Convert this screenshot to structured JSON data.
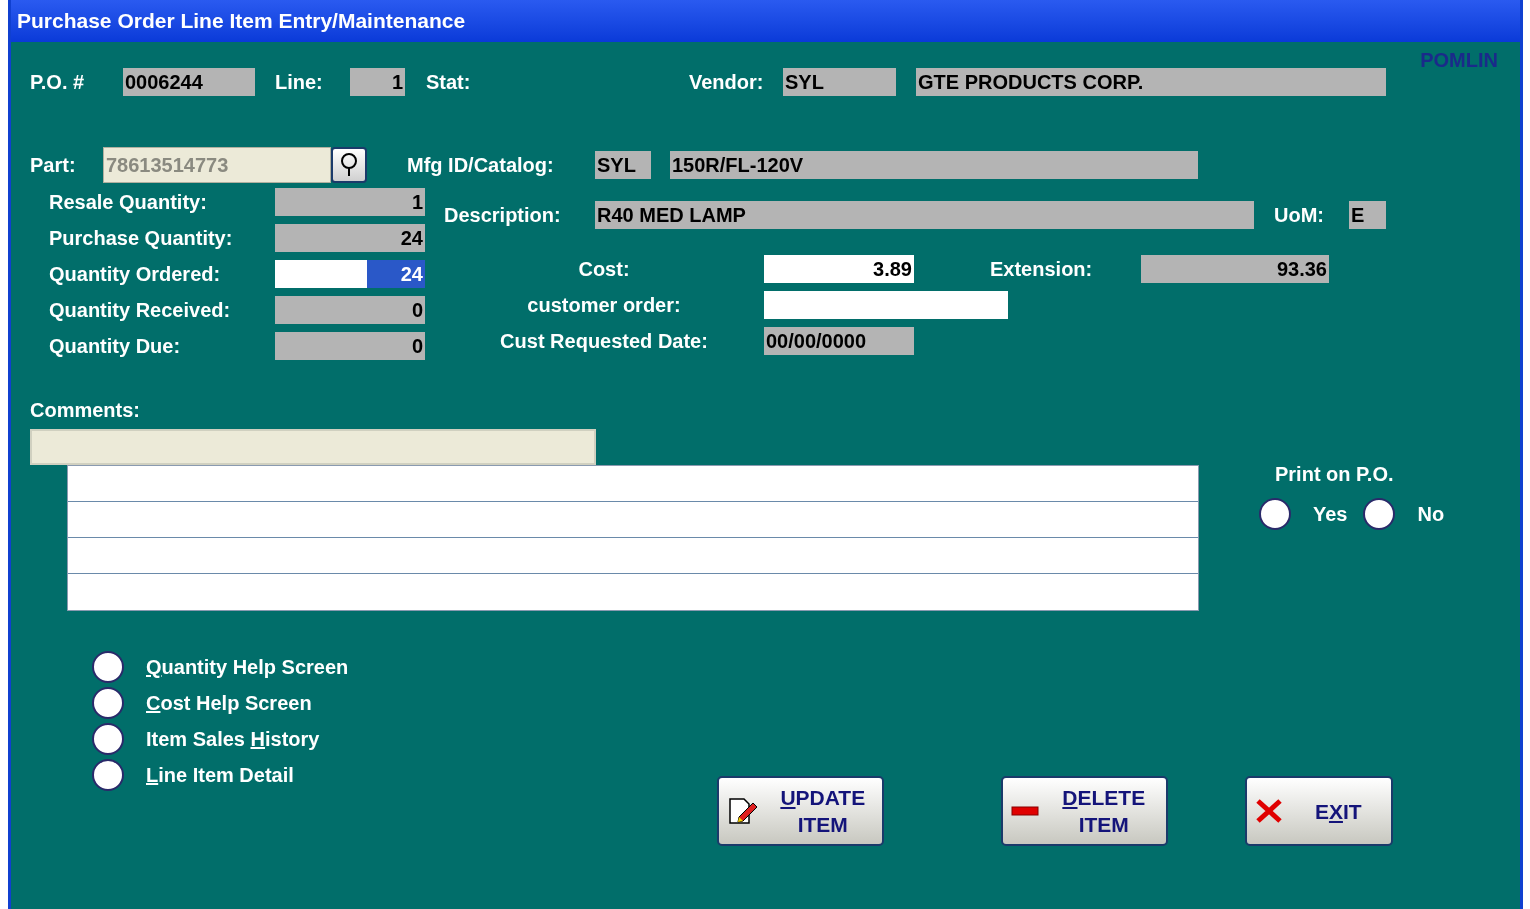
{
  "window": {
    "title": "Purchase Order Line Item Entry/Maintenance",
    "form_code": "POMLIN"
  },
  "header": {
    "po_label": "P.O. #",
    "po": "0006244",
    "line_label": "Line:",
    "line": "1",
    "stat_label": "Stat:",
    "vendor_label": "Vendor:",
    "vendor_code": "SYL",
    "vendor_name": "GTE PRODUCTS CORP."
  },
  "part": {
    "label": "Part:",
    "value": "78613514773",
    "disabled": true
  },
  "mfg": {
    "label": "Mfg ID/Catalog:",
    "code": "SYL",
    "catalog": "150R/FL-120V"
  },
  "description": {
    "label": "Description:",
    "value": "R40 MED LAMP",
    "uom_label": "UoM:",
    "uom": "E"
  },
  "quantities": [
    {
      "label": "Resale Quantity:",
      "value": "1",
      "kind": "readonly"
    },
    {
      "label": "Purchase Quantity:",
      "value": "24",
      "kind": "readonly"
    },
    {
      "label": "Quantity Ordered:",
      "value": "24",
      "kind": "editable",
      "text_selected": true
    },
    {
      "label": "Quantity Received:",
      "value": "0",
      "kind": "readonly"
    },
    {
      "label": "Quantity Due:",
      "value": "0",
      "kind": "readonly"
    }
  ],
  "pricing": [
    {
      "label": "Cost:",
      "value": "3.89",
      "kind": "amount"
    },
    {
      "label": "customer order:",
      "kind": "text"
    },
    {
      "label": "Cust Requested Date:",
      "value": "00/00/0000",
      "kind": "date"
    }
  ],
  "extension": {
    "label": "Extension:",
    "value": "93.36"
  },
  "comments": {
    "label": "Comments:"
  },
  "print_on_po": {
    "label": "Print on P.O.",
    "options": [
      {
        "label": "Yes",
        "selected": false
      },
      {
        "label": "No",
        "selected": false
      }
    ]
  },
  "options": [
    {
      "key": "Q",
      "after": "uantity Help Screen",
      "selected": false
    },
    {
      "key": "C",
      "after": "ost Help Screen",
      "selected": false
    },
    {
      "before": "Item Sales ",
      "key": "H",
      "after": "istory",
      "selected": false
    },
    {
      "key": "L",
      "after": "ine Item Detail",
      "selected": false
    }
  ],
  "buttons": [
    {
      "kind": "update",
      "key": "U",
      "after": "PDATE",
      "line2": "ITEM"
    },
    {
      "kind": "delete",
      "key": "D",
      "after": "ELETE",
      "line2": "ITEM"
    },
    {
      "kind": "exit",
      "before": "E",
      "key": "X",
      "after": "IT"
    }
  ]
}
